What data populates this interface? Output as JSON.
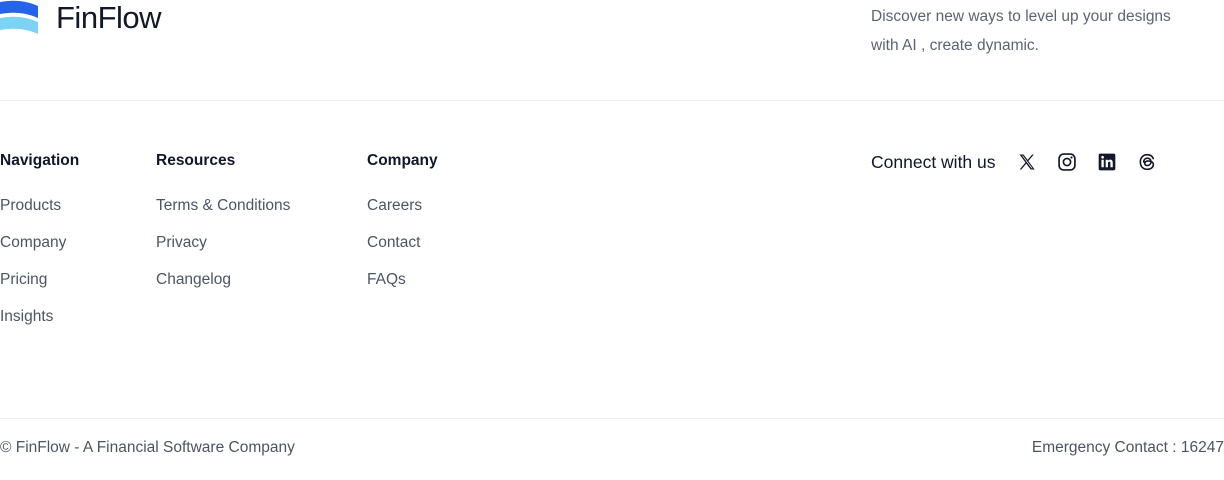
{
  "brand": {
    "name": "FinFlow",
    "colors": {
      "primary": "#2563eb",
      "secondary": "#60c8f0"
    }
  },
  "tagline": "Discover new ways to level up your designs with AI , create dynamic.",
  "columns": {
    "navigation": {
      "title": "Navigation",
      "links": [
        "Products",
        "Company",
        "Pricing",
        "Insights"
      ]
    },
    "resources": {
      "title": "Resources",
      "links": [
        "Terms & Conditions",
        "Privacy",
        "Changelog"
      ]
    },
    "company": {
      "title": "Company",
      "links": [
        "Careers",
        "Contact",
        "FAQs"
      ]
    }
  },
  "connect": {
    "label": "Connect with us",
    "icons": [
      "x-icon",
      "instagram-icon",
      "linkedin-icon",
      "threads-icon"
    ]
  },
  "bottom": {
    "copyright": "© FinFlow - A Financial Software Company",
    "emergency": "Emergency Contact : 16247"
  }
}
